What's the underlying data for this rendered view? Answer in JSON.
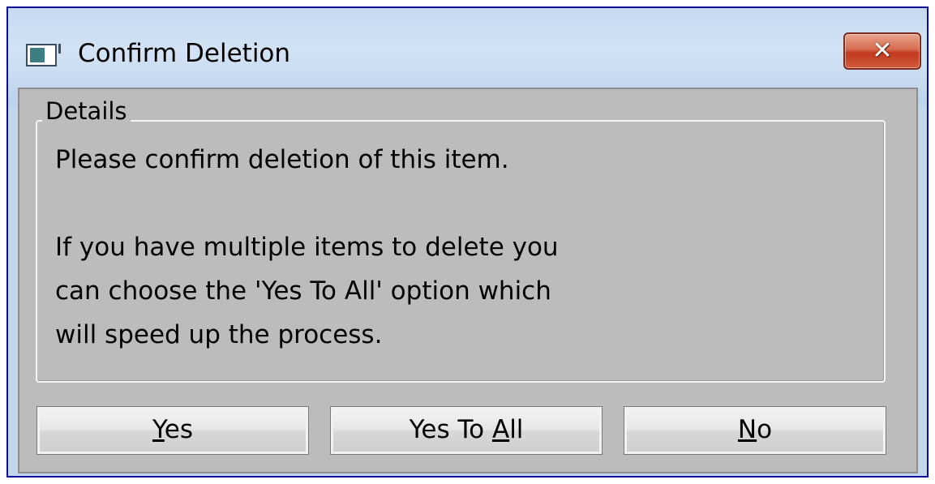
{
  "window": {
    "title": "Confirm Deletion",
    "icon": "app-window-icon",
    "close_glyph": "✕"
  },
  "details": {
    "legend": "Details",
    "line1": "Please confirm deletion of this item.",
    "line2": "If you have multiple items to delete you",
    "line3": "can choose the 'Yes To All' option which",
    "line4": "will speed up the process."
  },
  "buttons": {
    "yes": {
      "mnemonic": "Y",
      "rest": "es"
    },
    "yes_to_all": {
      "prefix": "Yes To ",
      "mnemonic": "A",
      "rest": "ll"
    },
    "no": {
      "mnemonic": "N",
      "rest": "o"
    }
  },
  "colors": {
    "title_border": "#0d0d96",
    "close_button": "#c2391d",
    "client_bg": "#bcbcbc"
  }
}
